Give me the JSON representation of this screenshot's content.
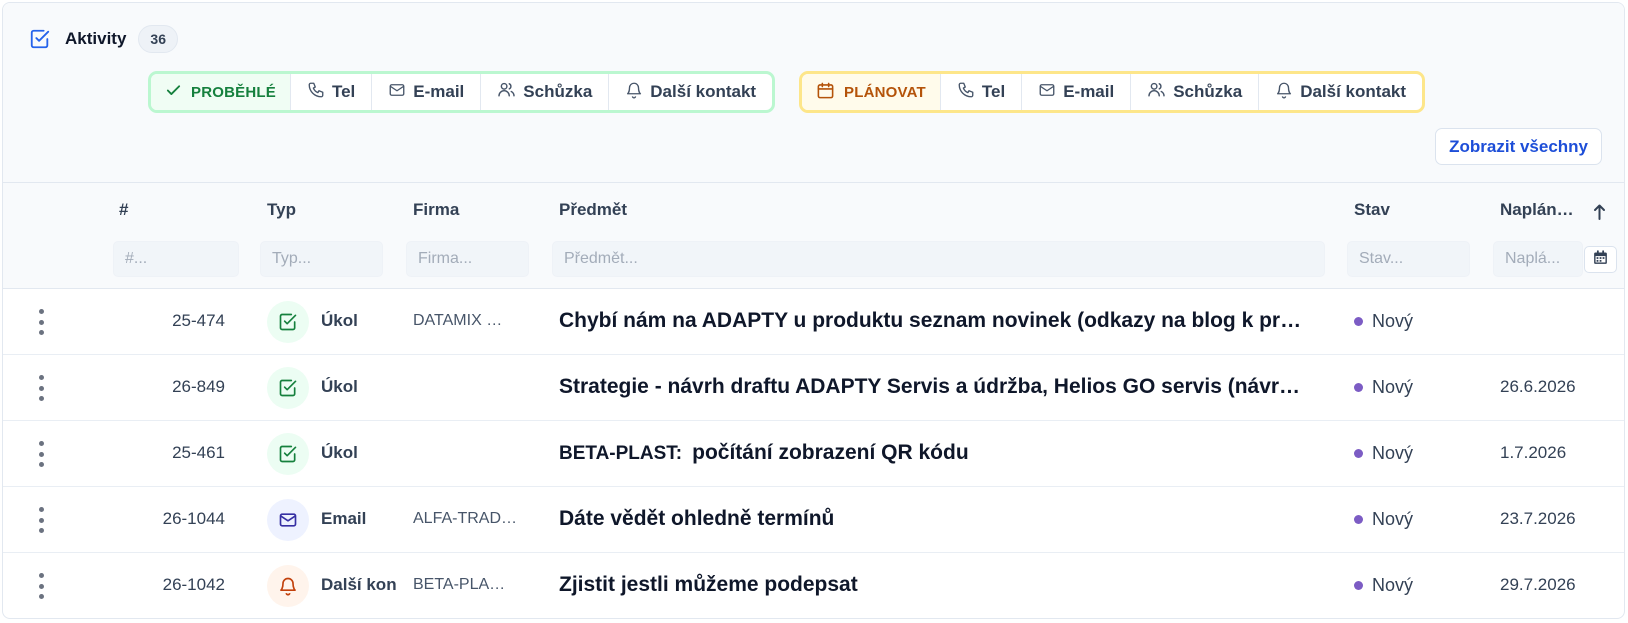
{
  "header": {
    "title": "Aktivity",
    "count": "36"
  },
  "done_group": {
    "label": "PROBĚHLÉ",
    "actions": [
      {
        "label": "Tel",
        "icon": "phone-icon"
      },
      {
        "label": "E-mail",
        "icon": "mail-icon"
      },
      {
        "label": "Schůzka",
        "icon": "users-icon"
      },
      {
        "label": "Další kontakt",
        "icon": "bell-icon"
      }
    ]
  },
  "plan_group": {
    "label": "PLÁNOVAT",
    "actions": [
      {
        "label": "Tel",
        "icon": "phone-icon"
      },
      {
        "label": "E-mail",
        "icon": "mail-icon"
      },
      {
        "label": "Schůzka",
        "icon": "users-icon"
      },
      {
        "label": "Další kontakt",
        "icon": "bell-icon"
      }
    ]
  },
  "show_all_label": "Zobrazit všechny",
  "columns": {
    "num": "#",
    "type": "Typ",
    "company": "Firma",
    "subject": "Předmět",
    "status": "Stav",
    "planned": "Naplán…"
  },
  "filters": {
    "num": "#...",
    "type": "Typ...",
    "company": "Firma...",
    "subject": "Předmět...",
    "status": "Stav...",
    "planned": "Naplá..."
  },
  "colors": {
    "done": "#15803d",
    "plan": "#b45309",
    "link": "#1d4ed8",
    "status_dot": "#7c5cc4"
  },
  "rows": [
    {
      "num": "25-474",
      "type": "Úkol",
      "type_icon": "task-check-icon",
      "company": "DATAMIX …",
      "prefix": "",
      "subject": "Chybí nám na ADAPTY u produktu seznam novinek (odkazy na blog k pr…",
      "status": "Nový",
      "date": ""
    },
    {
      "num": "26-849",
      "type": "Úkol",
      "type_icon": "task-check-icon",
      "company": "",
      "prefix": "",
      "subject": "Strategie - návrh draftu ADAPTY Servis a údržba, Helios GO servis (návr…",
      "status": "Nový",
      "date": "26.6.2026"
    },
    {
      "num": "25-461",
      "type": "Úkol",
      "type_icon": "task-check-icon",
      "company": "",
      "prefix": "BETA-PLAST:",
      "subject": "počítání zobrazení QR kódu",
      "status": "Nový",
      "date": "1.7.2026"
    },
    {
      "num": "26-1044",
      "type": "Email",
      "type_icon": "mail-icon",
      "company": "ALFA-TRAD…",
      "prefix": "",
      "subject": "Dáte vědět ohledně termínů",
      "status": "Nový",
      "date": "23.7.2026"
    },
    {
      "num": "26-1042",
      "type": "Další kon",
      "type_icon": "bell-icon",
      "company": "BETA-PLA…",
      "prefix": "",
      "subject": "Zjistit jestli můžeme podepsat",
      "status": "Nový",
      "date": "29.7.2026"
    }
  ]
}
